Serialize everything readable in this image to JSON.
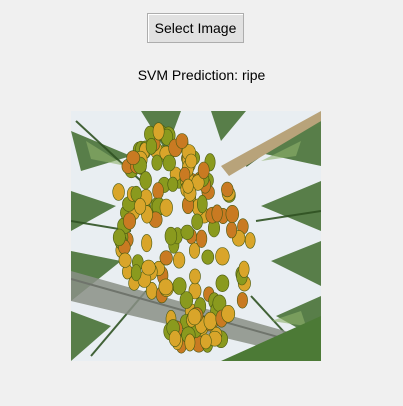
{
  "toolbar": {
    "select_label": "Select Image"
  },
  "result": {
    "text": "SVM Prediction: ripe"
  },
  "image": {
    "subject": "areca-nut-bunch-photo",
    "colors": {
      "sky": "#e9eef2",
      "frond": "#3f6b2c",
      "frond_light": "#8fb36a",
      "fruit_green": "#8a9a1e",
      "fruit_yellow": "#d9a52a",
      "fruit_orange": "#c97a22",
      "trunk": "#8a8f86"
    }
  }
}
